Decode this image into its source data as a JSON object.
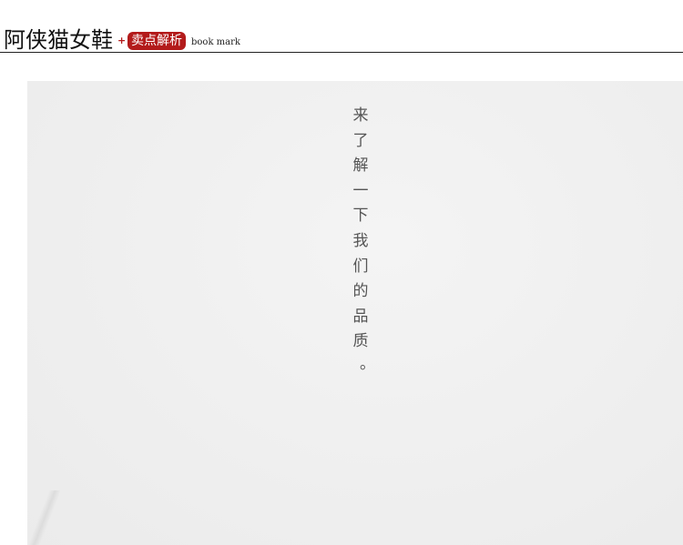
{
  "header": {
    "brand": "阿侠猫女鞋",
    "plus": "+",
    "badge": "卖点解析",
    "bookmark": "book mark"
  },
  "colors": {
    "accent": "#b31b1b",
    "panel_bg": "#f0f0f0",
    "text": "#555555"
  },
  "panel": {
    "chars": [
      "来",
      "了",
      "解",
      "一",
      "下",
      "我",
      "们",
      "的",
      "品",
      "质",
      "。"
    ]
  }
}
